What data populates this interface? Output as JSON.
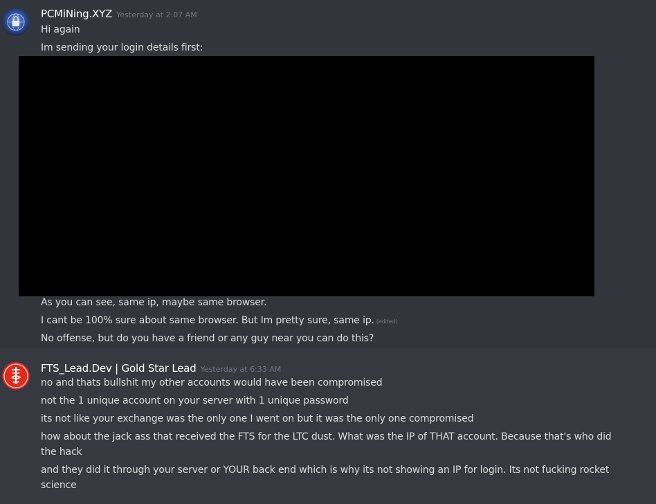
{
  "groups": [
    {
      "author": "PCMiNing.XYZ",
      "timestamp": "Yesterday at 2:07 AM",
      "avatar_icon": "lock-globe-icon",
      "messages": [
        {
          "text": "Hi again"
        },
        {
          "text": "Im sending your login details first:"
        },
        {
          "text": "As you can see, same ip, maybe same browser."
        },
        {
          "text": "I cant be 100% sure about same browser. But Im pretty sure, same ip.",
          "edited": "(edited)"
        },
        {
          "text": "No offense, but do you have a friend or any guy near you can do this?"
        }
      ]
    },
    {
      "author": "FTS_Lead.Dev | Gold Star Lead",
      "timestamp": "Yesterday at 6:33 AM",
      "avatar_icon": "fts-logo-icon",
      "messages": [
        {
          "text": "no and thats bullshit my other accounts would have been compromised"
        },
        {
          "text": "not the 1 unique account on your server with 1 unique password"
        },
        {
          "text": "its not like your exchange was the only one I went on but it was the only one compromised"
        },
        {
          "text": "how about the jack ass that received the FTS for the LTC dust. What was the IP of THAT account. Because that's who did the hack"
        },
        {
          "text": "and they did it through your server or YOUR back end which is why its not showing an IP for login. Its not fucking rocket science"
        }
      ]
    }
  ]
}
